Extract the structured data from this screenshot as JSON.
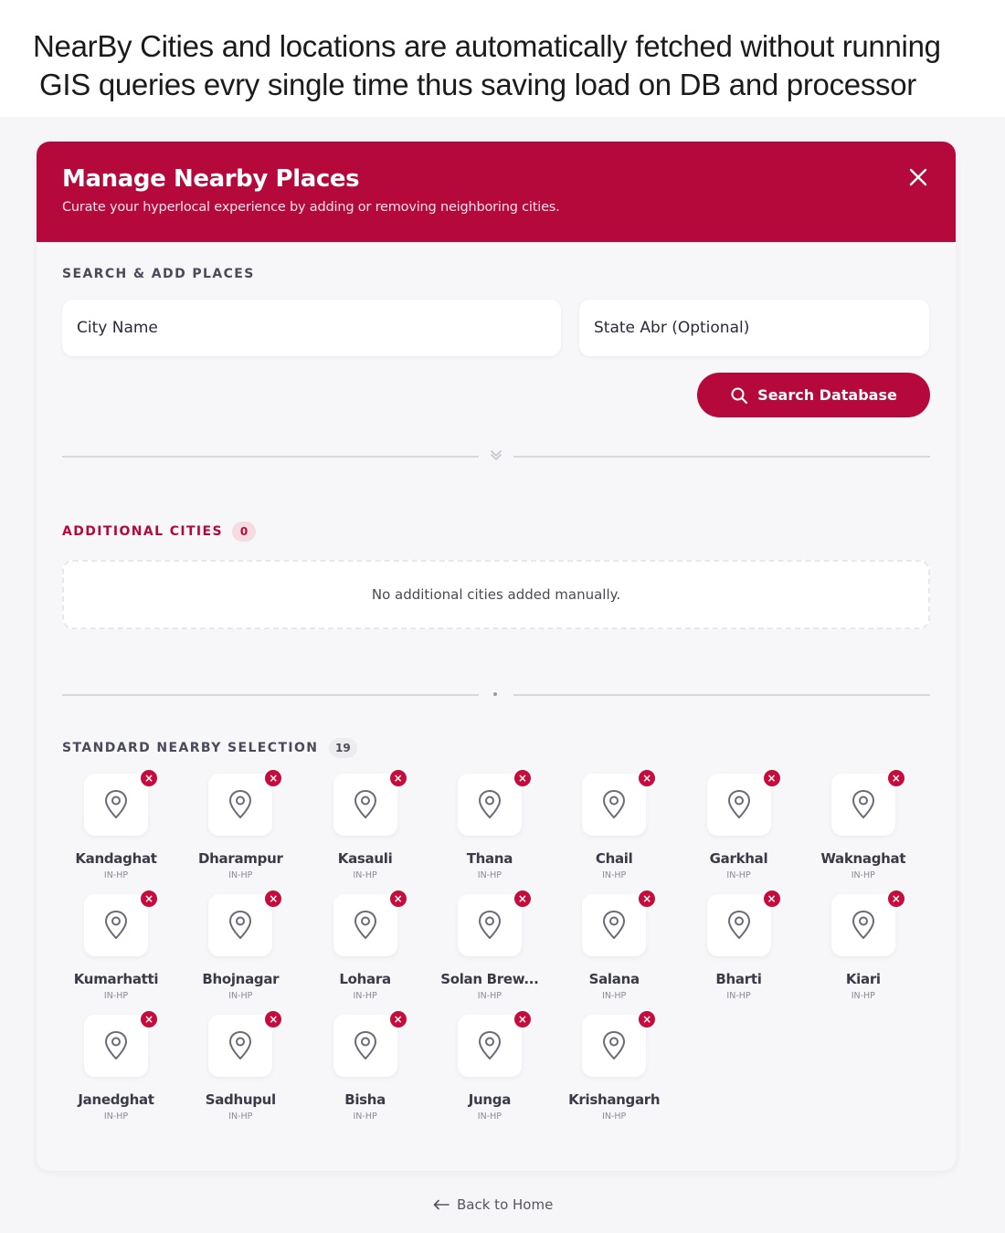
{
  "banner": {
    "line1": "NearBy Cities and locations are automatically fetched without running",
    "line2": "GIS queries evry single time thus saving load on DB and processor"
  },
  "modal": {
    "title": "Manage Nearby Places",
    "subtitle": "Curate your hyperlocal experience by adding or removing neighboring cities.",
    "close_icon": "close-icon"
  },
  "search": {
    "section_label": "SEARCH & ADD PLACES",
    "city_placeholder": "City Name",
    "state_placeholder": "State Abr (Optional)",
    "button_label": "Search Database"
  },
  "additional": {
    "label": "ADDITIONAL CITIES",
    "count": "0",
    "empty_text": "No additional cities added manually."
  },
  "standard": {
    "label": "STANDARD NEARBY SELECTION",
    "count": "19",
    "cities": [
      {
        "name": "Kandaghat",
        "code": "IN-HP"
      },
      {
        "name": "Dharampur",
        "code": "IN-HP"
      },
      {
        "name": "Kasauli",
        "code": "IN-HP"
      },
      {
        "name": "Thana",
        "code": "IN-HP"
      },
      {
        "name": "Chail",
        "code": "IN-HP"
      },
      {
        "name": "Garkhal",
        "code": "IN-HP"
      },
      {
        "name": "Waknaghat",
        "code": "IN-HP"
      },
      {
        "name": "Kumarhatti",
        "code": "IN-HP"
      },
      {
        "name": "Bhojnagar",
        "code": "IN-HP"
      },
      {
        "name": "Lohara",
        "code": "IN-HP"
      },
      {
        "name": "Solan Brew...",
        "code": "IN-HP"
      },
      {
        "name": "Salana",
        "code": "IN-HP"
      },
      {
        "name": "Bharti",
        "code": "IN-HP"
      },
      {
        "name": "Kiari",
        "code": "IN-HP"
      },
      {
        "name": "Janedghat",
        "code": "IN-HP"
      },
      {
        "name": "Sadhupul",
        "code": "IN-HP"
      },
      {
        "name": "Bisha",
        "code": "IN-HP"
      },
      {
        "name": "Junga",
        "code": "IN-HP"
      },
      {
        "name": "Krishangarh",
        "code": "IN-HP"
      }
    ]
  },
  "footer": {
    "back_label": "Back to Home"
  },
  "colors": {
    "accent": "#b5083b",
    "remove": "#c70b3c",
    "background": "#f6f6f8"
  }
}
